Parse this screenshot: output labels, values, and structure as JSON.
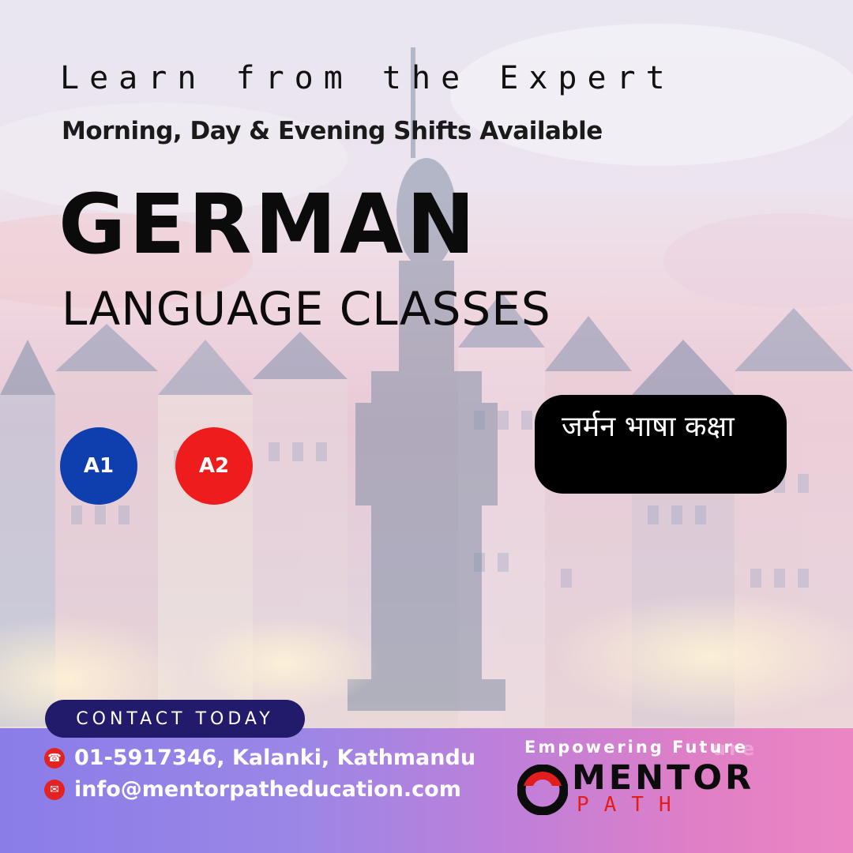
{
  "headline": {
    "tagline": "Learn from the Expert",
    "shifts": "Morning, Day & Evening Shifts Available",
    "title": "GERMAN",
    "subtitle": "LANGUAGE CLASSES"
  },
  "levels": [
    {
      "label": "A1",
      "color": "#0f3fae"
    },
    {
      "label": "A2",
      "color": "#ee1c1c"
    }
  ],
  "nepali_label": "जर्मन भाषा कक्षा",
  "contact": {
    "button_label": "CONTACT TODAY",
    "phone_address": "01-5917346, Kalanki, Kathmandu",
    "email": "info@mentorpatheducation.com",
    "phone_icon": "phone-icon",
    "email_icon": "mail-icon"
  },
  "brand": {
    "tagline": "Empowering Future",
    "tagline_ghost": "ure",
    "name": "MENTOR",
    "name_sub": "PATH",
    "accent_color": "#e11d1d"
  }
}
